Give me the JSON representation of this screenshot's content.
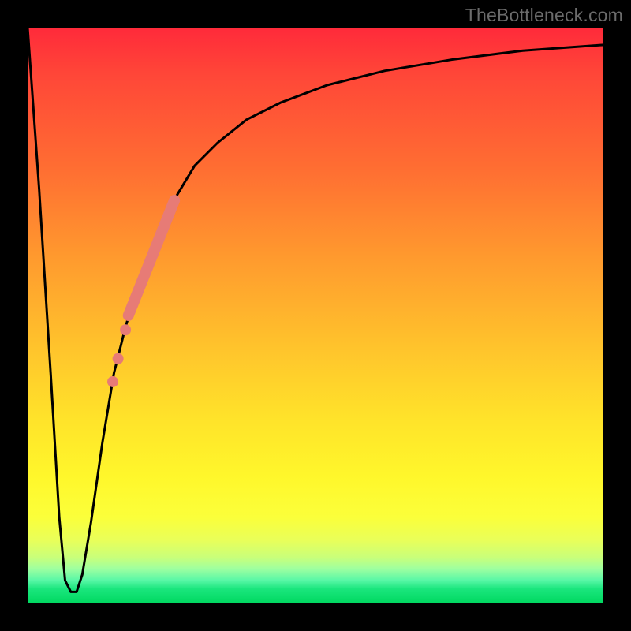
{
  "watermark": "TheBottleneck.com",
  "chart_data": {
    "type": "line",
    "title": "",
    "xlabel": "",
    "ylabel": "",
    "xlim": [
      0,
      100
    ],
    "ylim": [
      0,
      100
    ],
    "grid": false,
    "series": [
      {
        "name": "curve",
        "color": "#000000",
        "x": [
          0,
          2,
          4,
          5.5,
          6.5,
          7.5,
          8.5,
          9.5,
          11,
          13,
          15,
          17,
          20,
          23,
          26,
          29,
          33,
          38,
          44,
          52,
          62,
          74,
          86,
          100
        ],
        "y": [
          100,
          72,
          40,
          15,
          4,
          2,
          2,
          5,
          14,
          28,
          40,
          48,
          58,
          65,
          71,
          76,
          80,
          84,
          87,
          90,
          92.5,
          94.5,
          96,
          97
        ]
      }
    ],
    "highlight_segment": {
      "name": "thick-pink-segment",
      "color": "#e77b76",
      "x": [
        17.5,
        25.5
      ],
      "y": [
        50,
        70
      ]
    },
    "highlight_dots": {
      "name": "pink-dots",
      "color": "#e77b76",
      "points": [
        {
          "x": 17.0,
          "y": 47.5
        },
        {
          "x": 15.7,
          "y": 42.5
        },
        {
          "x": 14.8,
          "y": 38.5
        }
      ]
    }
  }
}
